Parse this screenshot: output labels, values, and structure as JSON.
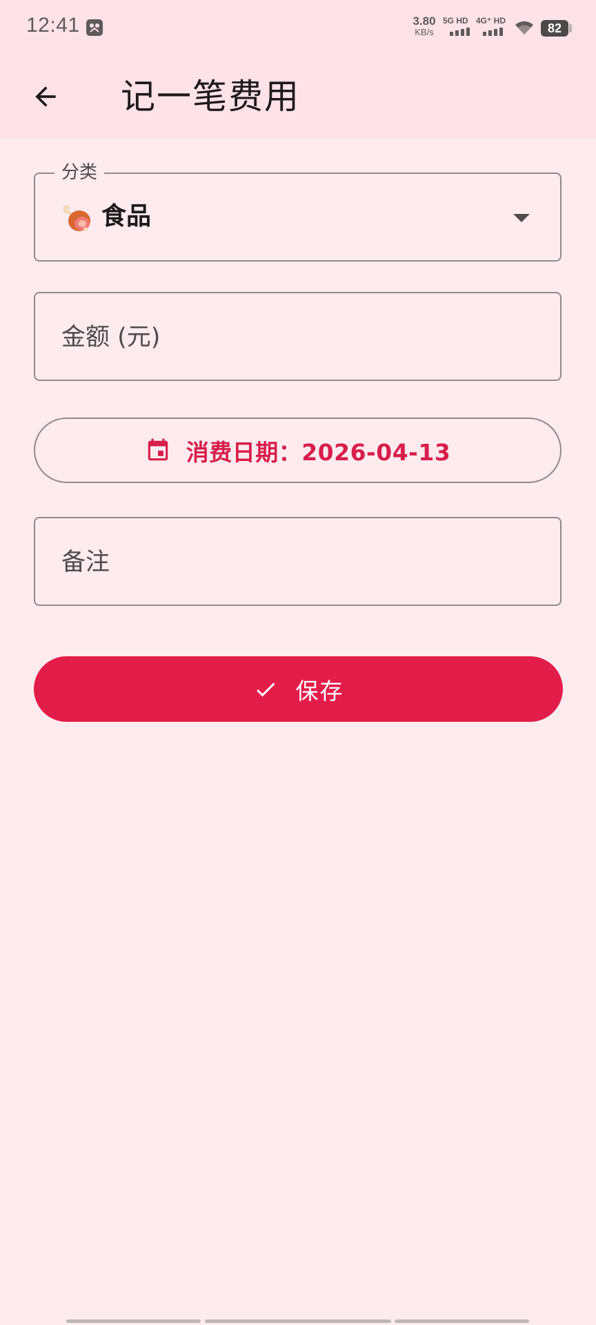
{
  "status_bar": {
    "time": "12:41",
    "net_speed_value": "3.80",
    "net_speed_unit": "KB/s",
    "sim1_label": "5G HD",
    "sim2_label": "4G⁺ HD",
    "battery": "82",
    "notification_icon": "gallery-icon",
    "wifi_icon": "wifi-icon"
  },
  "app_bar": {
    "back_icon": "arrow-left-icon",
    "title": "记一笔费用"
  },
  "form": {
    "category": {
      "label": "分类",
      "value": "食品",
      "icon": "meat-drumstick-icon"
    },
    "amount": {
      "placeholder": "金额 (元)",
      "value": ""
    },
    "date": {
      "label": "消费日期：2026-04-13",
      "icon": "calendar-icon"
    },
    "note": {
      "placeholder": "备注",
      "value": ""
    },
    "save": {
      "label": "保存",
      "icon": "check-icon"
    }
  },
  "colors": {
    "accent": "#e31d4a",
    "accent_text": "#d71e4c",
    "background": "#fdebee",
    "app_bar": "#fde2e7"
  }
}
